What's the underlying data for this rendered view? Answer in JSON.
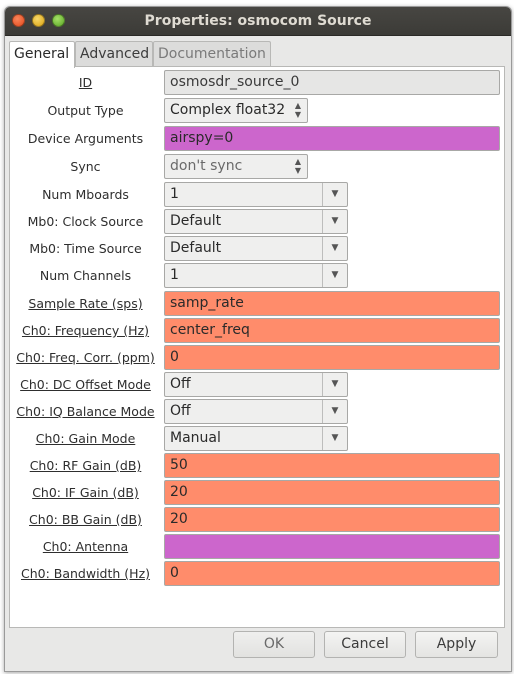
{
  "window": {
    "title": "Properties: osmocom Source"
  },
  "tabs": [
    {
      "label": "General",
      "active": true
    },
    {
      "label": "Advanced",
      "active": false
    },
    {
      "label": "Documentation",
      "active": false
    }
  ],
  "params": {
    "id": {
      "label": "ID",
      "value": "osmosdr_source_0"
    },
    "output_type": {
      "label": "Output Type",
      "value": "Complex float32"
    },
    "device_args": {
      "label": "Device Arguments",
      "value": "airspy=0"
    },
    "sync": {
      "label": "Sync",
      "value": "don't sync"
    },
    "num_mboards": {
      "label": "Num Mboards",
      "value": "1"
    },
    "clock_source": {
      "label": "Mb0: Clock Source",
      "value": "Default"
    },
    "time_source": {
      "label": "Mb0: Time Source",
      "value": "Default"
    },
    "num_channels": {
      "label": "Num Channels",
      "value": "1"
    },
    "sample_rate": {
      "label": "Sample Rate (sps)",
      "value": "samp_rate"
    },
    "frequency": {
      "label": "Ch0: Frequency (Hz)",
      "value": "center_freq"
    },
    "freq_corr": {
      "label": "Ch0: Freq. Corr. (ppm)",
      "value": "0"
    },
    "dc_offset": {
      "label": "Ch0: DC Offset Mode",
      "value": "Off"
    },
    "iq_balance": {
      "label": "Ch0: IQ Balance Mode",
      "value": "Off"
    },
    "gain_mode": {
      "label": "Ch0: Gain Mode",
      "value": "Manual"
    },
    "rf_gain": {
      "label": "Ch0: RF Gain (dB)",
      "value": "50"
    },
    "if_gain": {
      "label": "Ch0: IF Gain (dB)",
      "value": "20"
    },
    "bb_gain": {
      "label": "Ch0: BB Gain (dB)",
      "value": "20"
    },
    "antenna": {
      "label": "Ch0: Antenna",
      "value": ""
    },
    "bandwidth": {
      "label": "Ch0: Bandwidth (Hz)",
      "value": "0"
    }
  },
  "buttons": {
    "ok": "OK",
    "cancel": "Cancel",
    "apply": "Apply"
  },
  "colors": {
    "orange_field": "#ff8c6b",
    "purple_field": "#cc66cc",
    "titlebar": "#3c3b37"
  }
}
